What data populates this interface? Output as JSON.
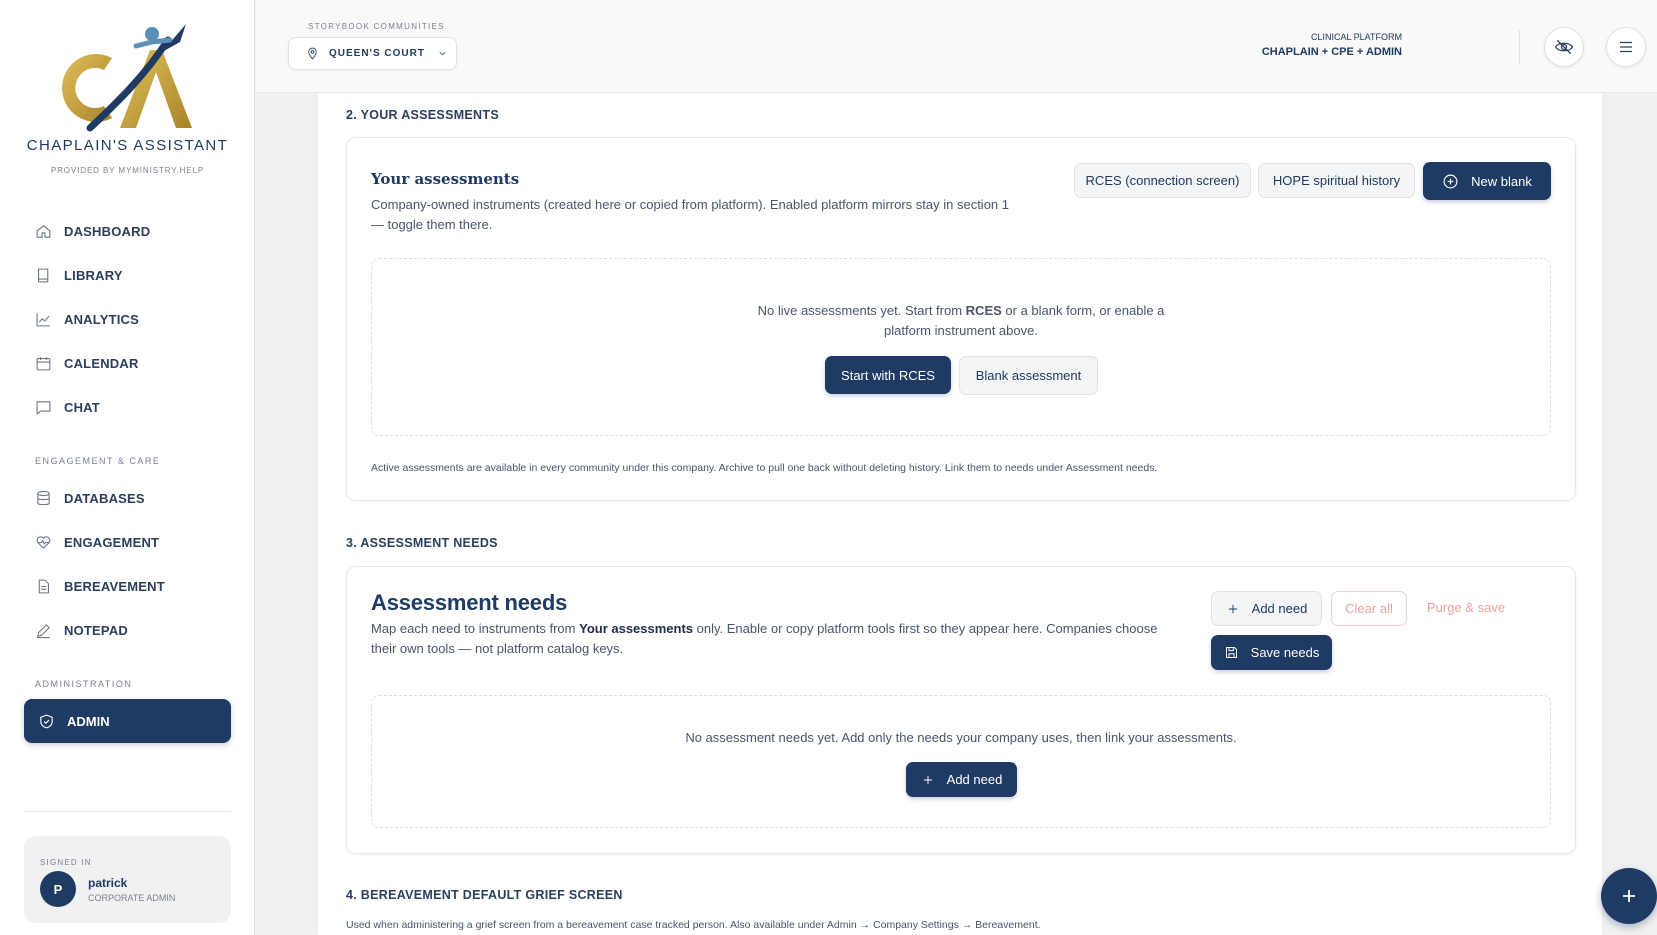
{
  "sidebar": {
    "brand_name": "CHAPLAIN'S ASSISTANT",
    "brand_sub": "PROVIDED BY MYMINISTRY.HELP",
    "main_items": [
      {
        "label": "DASHBOARD",
        "icon": "home-icon"
      },
      {
        "label": "LIBRARY",
        "icon": "book-icon"
      },
      {
        "label": "ANALYTICS",
        "icon": "chart-icon"
      },
      {
        "label": "CALENDAR",
        "icon": "calendar-icon"
      },
      {
        "label": "CHAT",
        "icon": "chat-icon"
      }
    ],
    "section_engagement": "ENGAGEMENT & CARE",
    "engagement_items": [
      {
        "label": "DATABASES",
        "icon": "database-icon"
      },
      {
        "label": "ENGAGEMENT",
        "icon": "heart-pulse-icon"
      },
      {
        "label": "BEREAVEMENT",
        "icon": "document-icon"
      },
      {
        "label": "NOTEPAD",
        "icon": "pen-icon"
      }
    ],
    "section_admin": "ADMINISTRATION",
    "admin_item": {
      "label": "ADMIN",
      "icon": "shield-icon"
    },
    "signed_in": {
      "label": "SIGNED IN",
      "initial": "P",
      "name": "patrick",
      "role": "CORPORATE ADMIN"
    }
  },
  "topbar": {
    "community_label": "STORYBOOK COMMUNITIES",
    "community_value": "QUEEN'S COURT",
    "platform_label": "CLINICAL PLATFORM",
    "platform_roles": "CHAPLAIN + CPE + ADMIN"
  },
  "sections": {
    "assessments": {
      "heading": "2. YOUR ASSESSMENTS",
      "title": "Your assessments",
      "desc_line1": "Company-owned instruments (created here or copied from platform). Enabled platform mirrors stay in section 1",
      "desc_line2": "— toggle them there.",
      "btn_rces": "RCES (connection screen)",
      "btn_hope": "HOPE spiritual history",
      "btn_new_blank": "New blank",
      "empty_pre": "No live assessments yet. Start from ",
      "empty_bold": "RCES",
      "empty_post": " or a blank form, or enable a",
      "empty_line2": "platform instrument above.",
      "btn_start_rces": "Start with RCES",
      "btn_blank": "Blank assessment",
      "footnote": "Active assessments are available in every community under this company. Archive to pull one back without deleting history. Link them to needs under Assessment needs."
    },
    "needs": {
      "heading": "3. ASSESSMENT NEEDS",
      "title": "Assessment needs",
      "desc_pre": "Map each need to instruments from ",
      "desc_bold": "Your assessments",
      "desc_post": " only. Enable or copy platform tools first so they appear here. Companies choose",
      "desc_line2": "their own tools — not platform catalog keys.",
      "btn_add_need": "Add need",
      "btn_clear_all": "Clear all",
      "btn_purge": "Purge & save",
      "btn_save": "Save needs",
      "empty_text": "No assessment needs yet. Add only the needs your company uses, then link your assessments.",
      "btn_add_need_center": "Add need"
    },
    "bereavement": {
      "heading": "4. BEREAVEMENT DEFAULT GRIEF SCREEN",
      "desc": "Used when administering a grief screen from a bereavement case tracked person. Also available under Admin → Company Settings → Bereavement."
    }
  },
  "colors": {
    "primary": "#1f3a63",
    "danger_light": "#f0a0a0",
    "gold": "#c9a53a"
  }
}
